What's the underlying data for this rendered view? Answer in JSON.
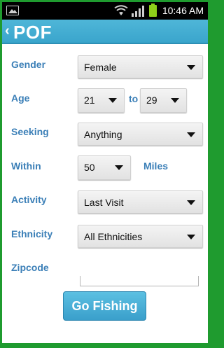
{
  "status_bar": {
    "time": "10:46 AM",
    "icons": [
      "image-notification-icon",
      "wifi-icon",
      "signal-icon",
      "battery-icon"
    ]
  },
  "app_bar": {
    "back_glyph": "‹",
    "title": "POF"
  },
  "form": {
    "gender": {
      "label": "Gender",
      "value": "Female"
    },
    "age": {
      "label": "Age",
      "min": "21",
      "to_label": "to",
      "max": "29"
    },
    "seeking": {
      "label": "Seeking",
      "value": "Anything"
    },
    "within": {
      "label": "Within",
      "value": "50",
      "unit": "Miles"
    },
    "activity": {
      "label": "Activity",
      "value": "Last Visit"
    },
    "ethnicity": {
      "label": "Ethnicity",
      "value": "All Ethnicities"
    },
    "zipcode": {
      "label": "Zipcode",
      "value": ""
    }
  },
  "actions": {
    "go_button": "Go Fishing"
  },
  "colors": {
    "accent": "#3aa5cc",
    "label": "#3b7fb7",
    "frame": "#1f9b2f"
  }
}
